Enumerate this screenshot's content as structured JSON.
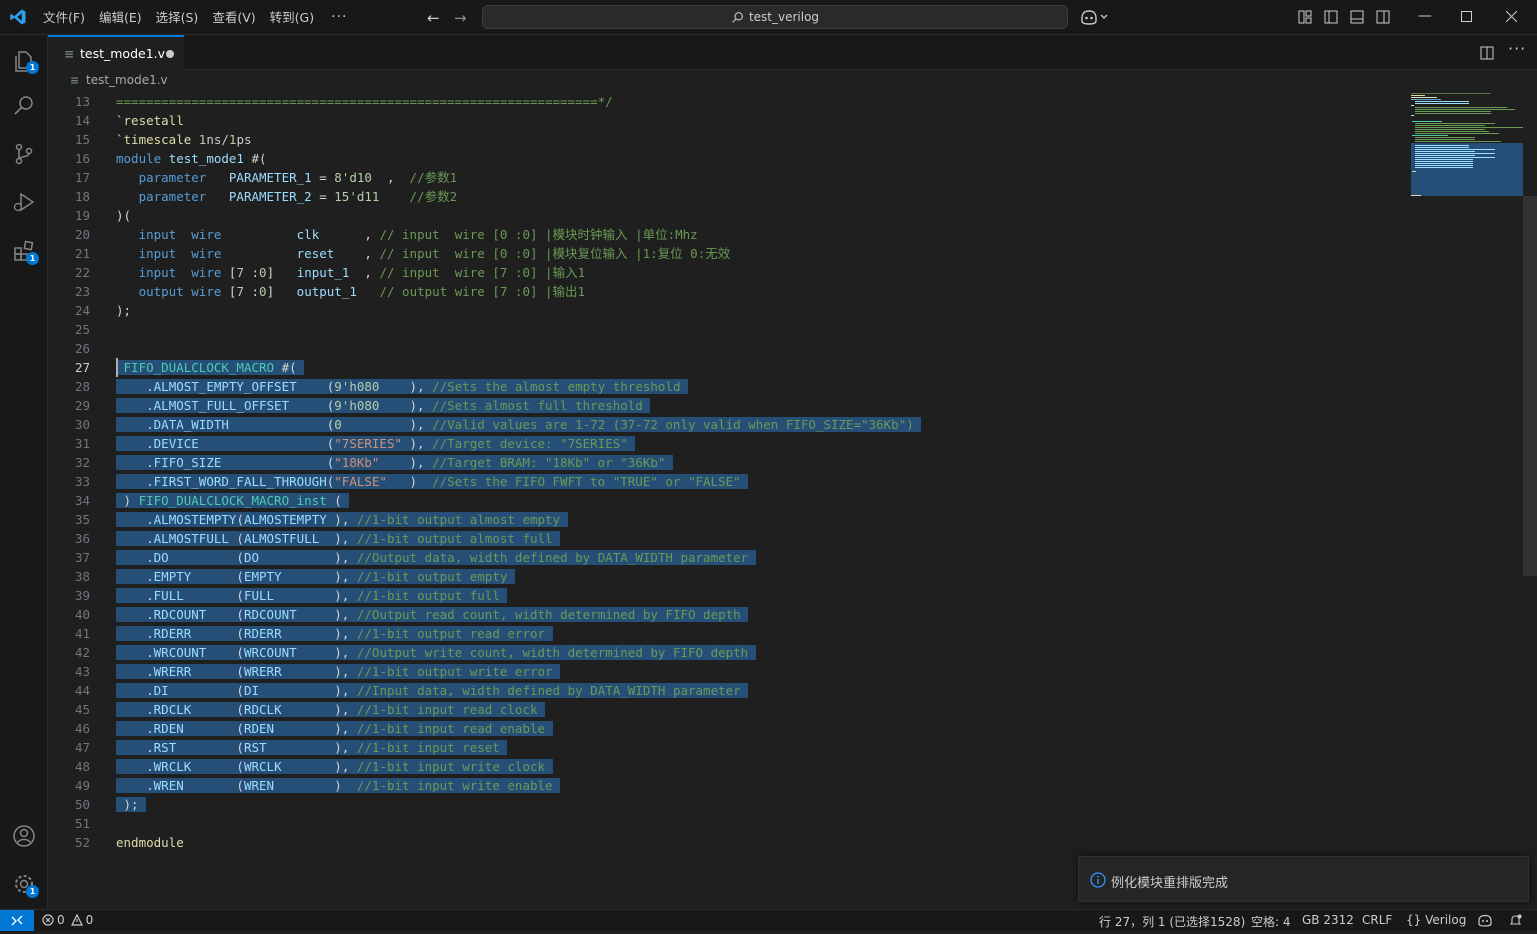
{
  "menu": [
    "文件(F)",
    "编辑(E)",
    "选择(S)",
    "查看(V)",
    "转到(G)",
    "···"
  ],
  "search": {
    "text": "test_verilog"
  },
  "tab": {
    "name": "test_mode1.v"
  },
  "breadcrumb": {
    "file": "test_mode1.v"
  },
  "editor": {
    "lines": [
      {
        "n": "13",
        "t": "================================================================*/"
      },
      {
        "n": "14",
        "t": "`resetall"
      },
      {
        "n": "15",
        "t": "`timescale 1ns/1ps"
      },
      {
        "n": "16",
        "t": "module test_mode1 #("
      },
      {
        "n": "17",
        "t": "   parameter   PARAMETER_1 = 8'd10  ,  //参数1"
      },
      {
        "n": "18",
        "t": "   parameter   PARAMETER_2 = 15'd11    //参数2"
      },
      {
        "n": "19",
        "t": ")("
      },
      {
        "n": "20",
        "t": "   input  wire          clk      , // input  wire [0 :0] |模块时钟输入 |单位:Mhz"
      },
      {
        "n": "21",
        "t": "   input  wire          reset    , // input  wire [0 :0] |模块复位输入 |1:复位 0:无效"
      },
      {
        "n": "22",
        "t": "   input  wire [7 :0]   input_1  , // input  wire [7 :0] |输入1"
      },
      {
        "n": "23",
        "t": "   output wire [7 :0]   output_1   // output wire [7 :0] |输出1"
      },
      {
        "n": "24",
        "t": ");"
      },
      {
        "n": "25",
        "t": ""
      },
      {
        "n": "26",
        "t": ""
      },
      {
        "n": "27",
        "t": " FIFO_DUALCLOCK_MACRO #("
      },
      {
        "n": "28",
        "t": "    .ALMOST_EMPTY_OFFSET    (9'h080    ), //Sets the almost empty threshold"
      },
      {
        "n": "29",
        "t": "    .ALMOST_FULL_OFFSET     (9'h080    ), //Sets almost full threshold"
      },
      {
        "n": "30",
        "t": "    .DATA_WIDTH             (0         ), //Valid values are 1-72 (37-72 only valid when FIFO_SIZE=\"36Kb\")"
      },
      {
        "n": "31",
        "t": "    .DEVICE                 (\"7SERIES\" ), //Target device: \"7SERIES\""
      },
      {
        "n": "32",
        "t": "    .FIFO_SIZE              (\"18Kb\"    ), //Target BRAM: \"18Kb\" or \"36Kb\""
      },
      {
        "n": "33",
        "t": "    .FIRST_WORD_FALL_THROUGH(\"FALSE\"   )  //Sets the FIFO FWFT to \"TRUE\" or \"FALSE\""
      },
      {
        "n": "34",
        "t": " ) FIFO_DUALCLOCK_MACRO_inst ("
      },
      {
        "n": "35",
        "t": "    .ALMOSTEMPTY(ALMOSTEMPTY ), //1-bit output almost empty"
      },
      {
        "n": "36",
        "t": "    .ALMOSTFULL (ALMOSTFULL  ), //1-bit output almost full"
      },
      {
        "n": "37",
        "t": "    .DO         (DO          ), //Output data, width defined by DATA_WIDTH parameter"
      },
      {
        "n": "38",
        "t": "    .EMPTY      (EMPTY       ), //1-bit output empty"
      },
      {
        "n": "39",
        "t": "    .FULL       (FULL        ), //1-bit output full"
      },
      {
        "n": "40",
        "t": "    .RDCOUNT    (RDCOUNT     ), //Output read count, width determined by FIFO depth"
      },
      {
        "n": "41",
        "t": "    .RDERR      (RDERR       ), //1-bit output read error"
      },
      {
        "n": "42",
        "t": "    .WRCOUNT    (WRCOUNT     ), //Output write count, width determined by FIFO depth"
      },
      {
        "n": "43",
        "t": "    .WRERR      (WRERR       ), //1-bit output write error"
      },
      {
        "n": "44",
        "t": "    .DI         (DI          ), //Input data, width defined by DATA_WIDTH parameter"
      },
      {
        "n": "45",
        "t": "    .RDCLK      (RDCLK       ), //1-bit input read clock"
      },
      {
        "n": "46",
        "t": "    .RDEN       (RDEN        ), //1-bit input read enable"
      },
      {
        "n": "47",
        "t": "    .RST        (RST         ), //1-bit input reset"
      },
      {
        "n": "48",
        "t": "    .WRCLK      (WRCLK       ), //1-bit input write clock"
      },
      {
        "n": "49",
        "t": "    .WREN       (WREN        )  //1-bit input write enable"
      },
      {
        "n": "50",
        "t": " );"
      },
      {
        "n": "51",
        "t": ""
      },
      {
        "n": "52",
        "t": "endmodule"
      }
    ]
  },
  "notification": {
    "message": "例化模块重排版完成"
  },
  "status": {
    "errors": "0",
    "warnings": "0",
    "position": "行 27，列 1 (已选择1528)",
    "spaces": "空格: 4",
    "encoding": "GB 2312",
    "eol": "CRLF",
    "language": "Verilog"
  },
  "badges": {
    "explorer": "1",
    "extensions": "1",
    "settings": "1"
  },
  "colors": {
    "accent": "#0078d4",
    "selection": "#264f78",
    "background": "#1f1f1f"
  }
}
